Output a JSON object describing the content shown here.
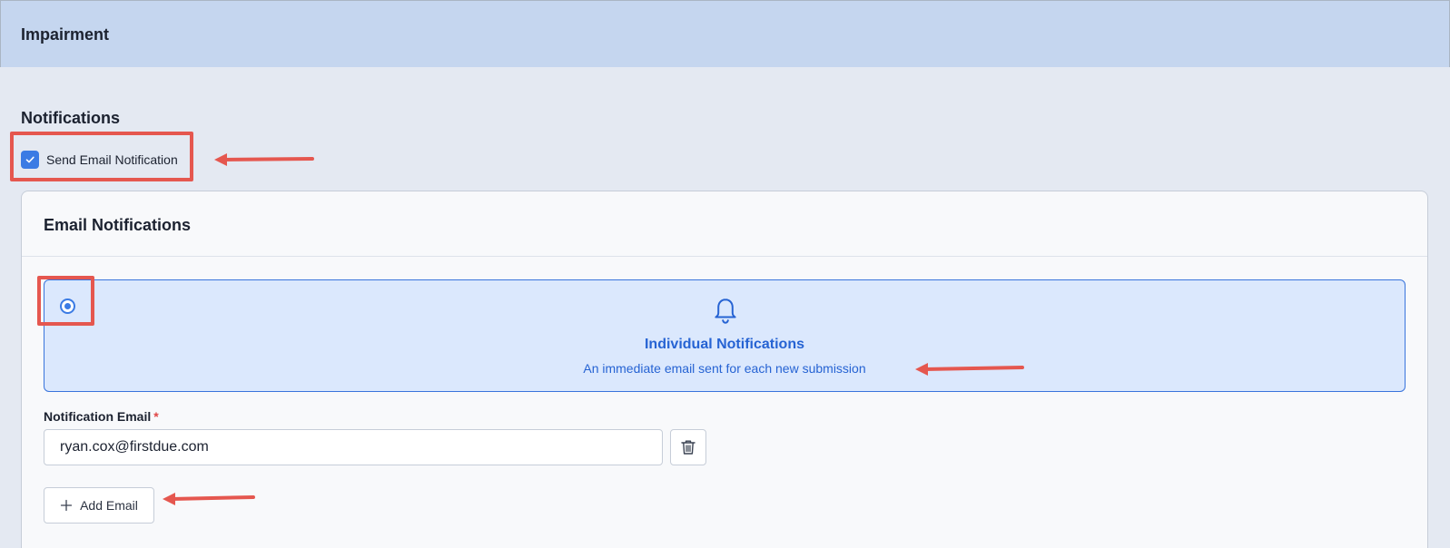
{
  "header": {
    "title": "Impairment"
  },
  "notifications": {
    "section_title": "Notifications",
    "send_email_label": "Send Email Notification",
    "send_email_checked": true
  },
  "email_card": {
    "title": "Email Notifications",
    "option": {
      "title": "Individual Notifications",
      "description": "An immediate email sent for each new submission",
      "selected": true,
      "icon": "bell-icon"
    },
    "field": {
      "label": "Notification Email",
      "required_marker": "*",
      "value": "ryan.cox@firstdue.com"
    },
    "delete_icon": "trash-icon",
    "add_email_label": "Add Email",
    "add_icon": "plus-icon"
  },
  "colors": {
    "accent": "#3b7be4",
    "header_bg": "#c5d6ef",
    "tile_bg": "#dbe8fd",
    "annotation": "#e5574f"
  }
}
